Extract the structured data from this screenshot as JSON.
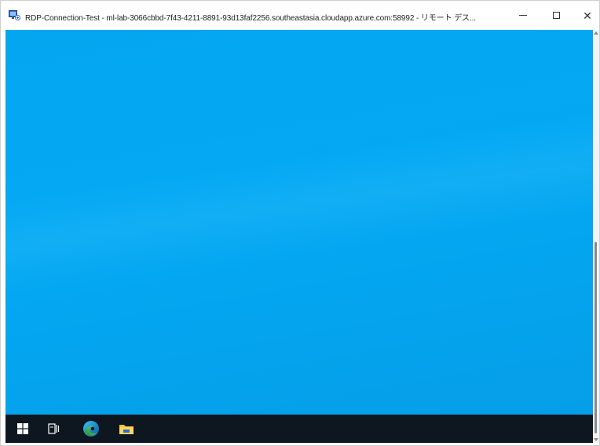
{
  "window": {
    "title": "RDP-Connection-Test - ml-lab-3066cbbd-7f43-4211-8891-93d13faf2256.southeastasia.cloudapp.azure.com:58992 - リモート デス...",
    "icon": "remote-desktop-icon",
    "controls": {
      "minimize_icon": "minimize-icon",
      "maximize_icon": "maximize-icon",
      "close_label": "✕"
    }
  },
  "desktop": {
    "background_color": "#03a9f4"
  },
  "taskbar": {
    "background_color": "#0e1620",
    "items": [
      {
        "name": "start",
        "icon": "windows-logo-icon"
      },
      {
        "name": "task-view",
        "icon": "task-view-icon"
      },
      {
        "name": "edge",
        "icon": "edge-icon"
      },
      {
        "name": "file-explorer",
        "icon": "folder-icon"
      }
    ]
  }
}
